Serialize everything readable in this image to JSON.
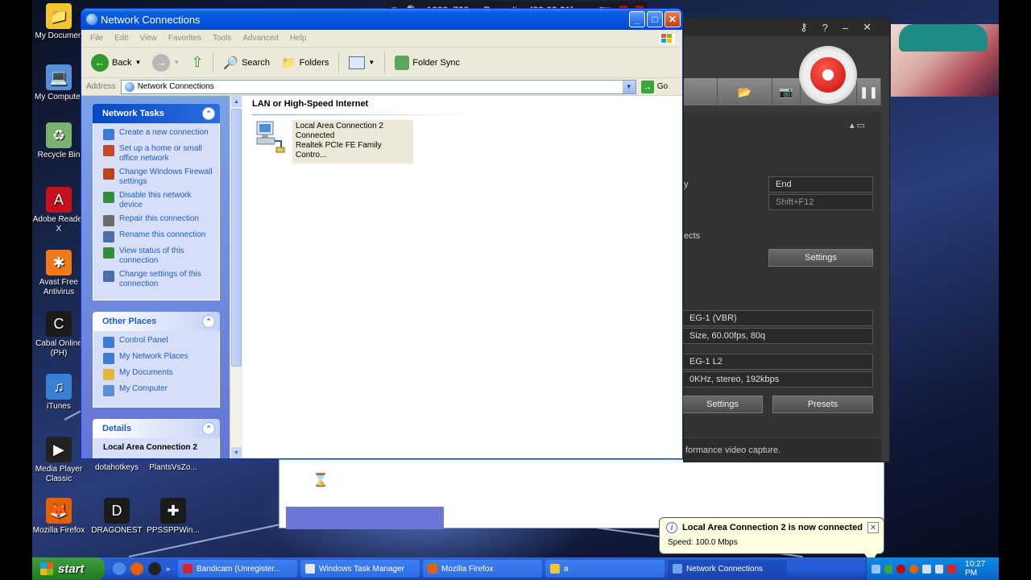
{
  "recording_hud": {
    "resolution": "1280x768",
    "status": "Recording [00:00:31]"
  },
  "desktop_icons": [
    {
      "label": "My Documen",
      "color": "#f2c531",
      "glyph": "📁"
    },
    {
      "label": "My Computer",
      "color": "#5a8fd8",
      "glyph": "💻"
    },
    {
      "label": "Recycle Bin",
      "color": "#7ab26f",
      "glyph": "♻"
    },
    {
      "label": "Adobe Reader X",
      "color": "#c8101d",
      "glyph": "A"
    },
    {
      "label": "Avast Free Antivirus",
      "color": "#f07a18",
      "glyph": "✱"
    },
    {
      "label": "Cabal Online (PH)",
      "color": "#1b1b1b",
      "glyph": "C"
    },
    {
      "label": "iTunes",
      "color": "#3a80d8",
      "glyph": "♫"
    },
    {
      "label": "Media Player Classic",
      "color": "#222222",
      "glyph": "▶"
    },
    {
      "label": "dotahotkeys",
      "color": "#2b2b2b",
      "glyph": ""
    },
    {
      "label": "PlantsVsZo...",
      "color": "#2b2b2b",
      "glyph": ""
    },
    {
      "label": "Mozilla Firefox",
      "color": "#e66000",
      "glyph": "🦊"
    },
    {
      "label": "DRAGONEST",
      "color": "#1b1b1b",
      "glyph": "D"
    },
    {
      "label": "PPSSPPWin...",
      "color": "#1b1b1b",
      "glyph": "✚"
    }
  ],
  "window": {
    "title": "Network Connections",
    "menu": [
      "File",
      "Edit",
      "View",
      "Favorites",
      "Tools",
      "Advanced",
      "Help"
    ],
    "toolbar": {
      "back": "Back",
      "search": "Search",
      "folders": "Folders",
      "folder_sync": "Folder Sync"
    },
    "address_label": "Address",
    "address_value": "Network Connections",
    "go_label": "Go",
    "network_tasks": {
      "title": "Network Tasks",
      "items": [
        {
          "label": "Create a new connection",
          "color": "#3b7bd4"
        },
        {
          "label": "Set up a home or small office network",
          "color": "#c4462a"
        },
        {
          "label": "Change Windows Firewall settings",
          "color": "#b8441f"
        },
        {
          "label": "Disable this network device",
          "color": "#2f8f3a"
        },
        {
          "label": "Repair this connection",
          "color": "#6a6a6a"
        },
        {
          "label": "Rename this connection",
          "color": "#4a6ea8"
        },
        {
          "label": "View status of this connection",
          "color": "#2f8f3a"
        },
        {
          "label": "Change settings of this connection",
          "color": "#4a6ea8"
        }
      ]
    },
    "other_places": {
      "title": "Other Places",
      "items": [
        {
          "label": "Control Panel",
          "color": "#3b7bd4"
        },
        {
          "label": "My Network Places",
          "color": "#3b7bd4"
        },
        {
          "label": "My Documents",
          "color": "#e2b73a"
        },
        {
          "label": "My Computer",
          "color": "#5a8fd8"
        }
      ]
    },
    "details": {
      "title": "Details",
      "name": "Local Area Connection 2"
    },
    "group_header": "LAN or High-Speed Internet",
    "connection": {
      "name": "Local Area Connection 2",
      "status": "Connected",
      "device": "Realtek PCIe FE Family Contro..."
    }
  },
  "bandicam": {
    "fields": {
      "hotkey_label_fragment": "y",
      "hotkey_value": "End",
      "hotkey_value2": "Shift+F12",
      "effects_fragment": "ects",
      "settings": "Settings",
      "video_codec": "EG-1 (VBR)",
      "video_params": "Size, 60.00fps, 80q",
      "audio_codec": "EG-1 L2",
      "audio_params": "0KHz, stereo, 192kbps",
      "settings2": "Settings",
      "presets": "Presets",
      "footer": "formance video capture."
    }
  },
  "balloon": {
    "title": "Local Area Connection 2 is now connected",
    "body": "Speed: 100.0 Mbps"
  },
  "taskbar": {
    "start": "start",
    "tasks": [
      {
        "label": "Bandicam (Unregister...",
        "color": "#d8232a",
        "active": false
      },
      {
        "label": "Windows Task Manager",
        "color": "#e6e6e6",
        "active": false
      },
      {
        "label": "Mozilla Firefox",
        "color": "#e66000",
        "active": false
      },
      {
        "label": "a",
        "color": "#f2c531",
        "active": false
      },
      {
        "label": "Network Connections",
        "color": "#6aa6e8",
        "active": true
      }
    ],
    "clock": "10:27 PM"
  }
}
